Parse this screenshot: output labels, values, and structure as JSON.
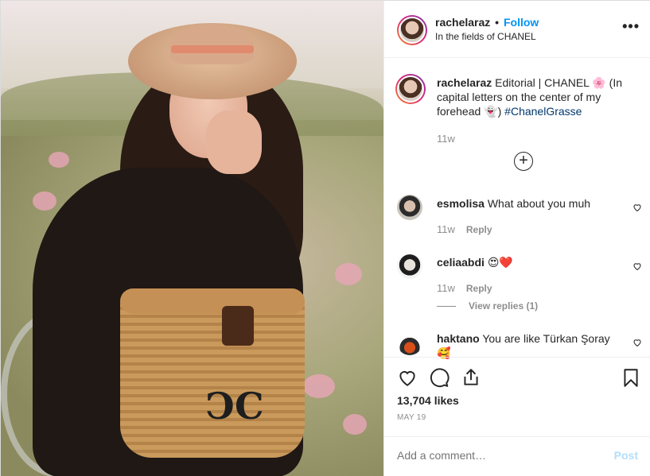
{
  "header": {
    "username": "rachelaraz",
    "dot": "•",
    "follow_label": "Follow",
    "location": "In the fields of CHANEL",
    "more_label": "•••"
  },
  "caption": {
    "username": "rachelaraz",
    "text_1": "Editorial | CHANEL",
    "emoji_1": "🌸",
    "text_2": "(In capital letters on the center of my forehead",
    "emoji_2": "👻",
    "text_3": ")",
    "hashtag": "#ChanelGrasse",
    "time": "11w",
    "load_more": "+"
  },
  "comments": [
    {
      "username": "esmolisa",
      "text": "What about you muh",
      "time": "11w",
      "reply": "Reply"
    },
    {
      "username": "celiaabdi",
      "text": "😍❤️",
      "time": "11w",
      "reply": "Reply",
      "view_replies": "View replies (1)"
    },
    {
      "username": "haktano",
      "text": "You are like Türkan Şoray 🥰",
      "time": "",
      "reply": ""
    }
  ],
  "actions": {
    "likes": "13,704 likes",
    "date": "MAY 19"
  },
  "add_comment": {
    "placeholder": "Add a comment…",
    "post_label": "Post"
  },
  "colors": {
    "accent": "#0095f6",
    "muted": "#8e8e8e",
    "post_disabled": "#b2dffc",
    "hashtag": "#00376b"
  }
}
